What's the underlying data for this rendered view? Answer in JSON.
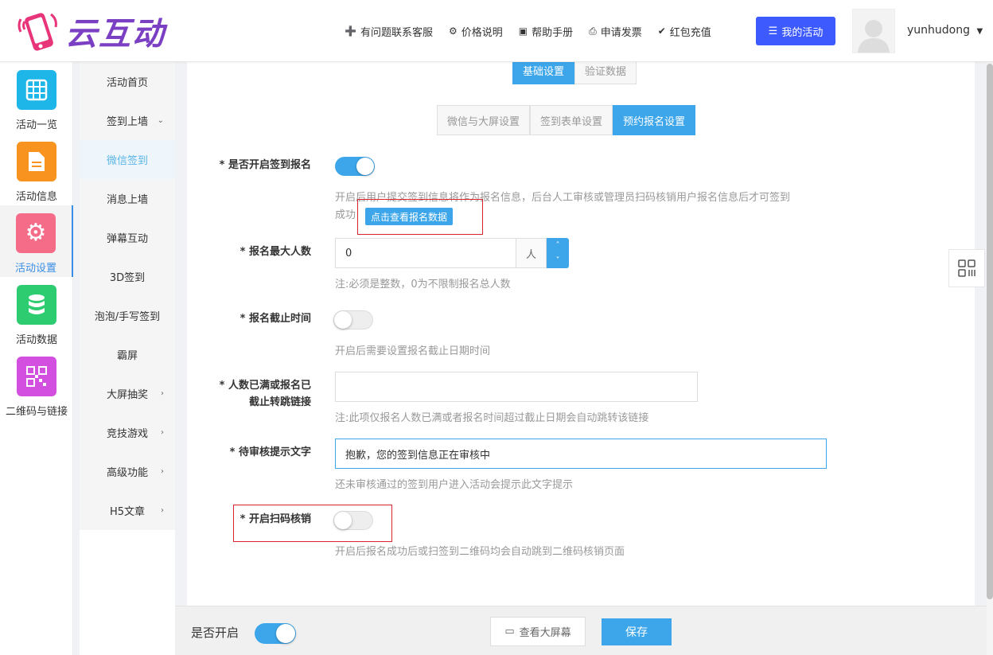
{
  "brand": {
    "name": "云互动"
  },
  "nav": [
    {
      "icon": "user-plus-icon",
      "label": "有问题联系客服"
    },
    {
      "icon": "gear-icon",
      "label": "价格说明"
    },
    {
      "icon": "book-icon",
      "label": "帮助手册"
    },
    {
      "icon": "printer-icon",
      "label": "申请发票"
    },
    {
      "icon": "shield-check-icon",
      "label": "红包充值"
    }
  ],
  "my_activity": "我的活动",
  "user": {
    "name": "yunhudong"
  },
  "iconbar": [
    {
      "label": "活动一览",
      "color": "#1eb6e9",
      "icon": "grid-icon"
    },
    {
      "label": "活动信息",
      "color": "#f7931e",
      "icon": "document-icon"
    },
    {
      "label": "活动设置",
      "color": "#f56c89",
      "icon": "gear-icon",
      "active": true
    },
    {
      "label": "活动数据",
      "color": "#2ecc71",
      "icon": "database-icon"
    },
    {
      "label": "二维码与链接",
      "color": "#d24fe0",
      "icon": "qrcode-icon"
    }
  ],
  "subnav": [
    {
      "label": "活动首页",
      "chev": ""
    },
    {
      "label": "签到上墙",
      "chev": "⌄"
    },
    {
      "label": "微信签到",
      "chev": "",
      "active": true
    },
    {
      "label": "消息上墙",
      "chev": ""
    },
    {
      "label": "弹幕互动",
      "chev": ""
    },
    {
      "label": "3D签到",
      "chev": ""
    },
    {
      "label": "泡泡/手写签到",
      "chev": ""
    },
    {
      "label": "霸屏",
      "chev": ""
    },
    {
      "label": "大屏抽奖",
      "chev": "›"
    },
    {
      "label": "竞技游戏",
      "chev": "›"
    },
    {
      "label": "高级功能",
      "chev": "›"
    },
    {
      "label": "H5文章",
      "chev": "›"
    }
  ],
  "tabs_top": [
    "基础设置",
    "验证数据"
  ],
  "tabs_sub": [
    "微信与大屏设置",
    "签到表单设置",
    "预约报名设置"
  ],
  "form": {
    "enable_signup": {
      "label": "* 是否开启签到报名",
      "on": true,
      "hint_line1": "开启后用户提交签到信息将作为报名信息，后台人工审核或管理员扫码核销用户报名信息后才可签到",
      "hint_line2": "成功",
      "button": "点击查看报名数据"
    },
    "max_people": {
      "label": "* 报名最大人数",
      "value": "0",
      "suffix": "人",
      "hint": "注:必须是整数，0为不限制报名总人数"
    },
    "deadline": {
      "label": "* 报名截止时间",
      "on": false,
      "hint": "开启后需要设置报名截止日期时间"
    },
    "redirect": {
      "label_line1": "* 人数已满或报名已",
      "label_line2": "截止转跳链接",
      "value": "",
      "hint": "注:此项仅报名人数已满或者报名时间超过截止日期会自动跳转该链接"
    },
    "pending_text": {
      "label": "* 待审核提示文字",
      "value": "抱歉，您的签到信息正在审核中",
      "hint": "还未审核通过的签到用户进入活动会提示此文字提示"
    },
    "scan_verify": {
      "label": "* 开启扫码核销",
      "on": false,
      "hint": "开启后报名成功后或扫签到二维码均会自动跳到二维码核销页面"
    }
  },
  "footer": {
    "label": "是否开启",
    "on": true,
    "view_button": "查看大屏幕",
    "save_button": "保存"
  }
}
